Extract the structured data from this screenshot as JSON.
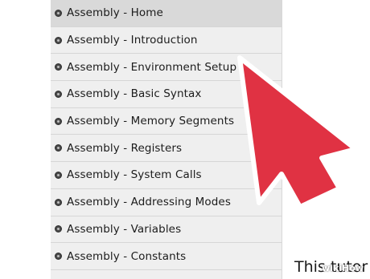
{
  "sidebar": {
    "items": [
      {
        "label": "Assembly - Home",
        "active": true
      },
      {
        "label": "Assembly - Introduction"
      },
      {
        "label": "Assembly - Environment Setup"
      },
      {
        "label": "Assembly - Basic Syntax"
      },
      {
        "label": "Assembly - Memory Segments"
      },
      {
        "label": "Assembly - Registers"
      },
      {
        "label": "Assembly - System Calls"
      },
      {
        "label": "Assembly - Addressing Modes"
      },
      {
        "label": "Assembly - Variables"
      },
      {
        "label": "Assembly - Constants"
      }
    ]
  },
  "content": {
    "snippet": "This tutor"
  },
  "watermark": {
    "text": "wikiHow"
  },
  "colors": {
    "sidebar_bg": "#efefef",
    "active_bg": "#d9d9d9",
    "cursor_fill": "#e03243",
    "cursor_outline": "#ffffff"
  },
  "icons": {
    "nav_bullet": "bullet-icon",
    "cursor": "mouse-pointer-icon"
  }
}
